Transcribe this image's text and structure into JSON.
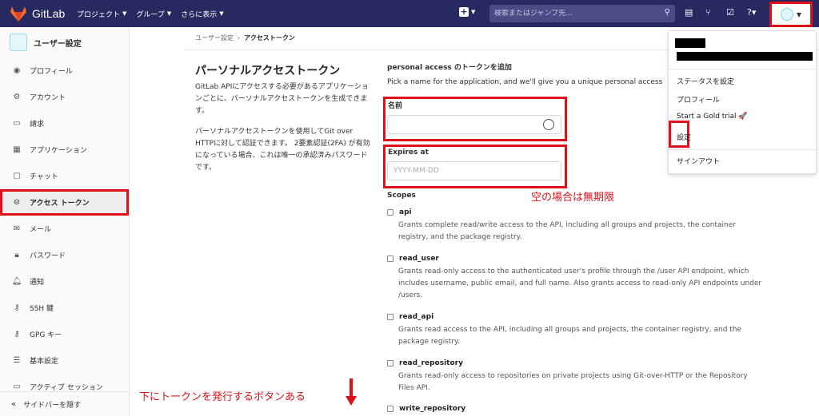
{
  "topbar": {
    "logo_text": "GitLab",
    "nav": [
      "プロジェクト",
      "グループ",
      "さらに表示"
    ],
    "search_placeholder": "検索またはジャンプ先..."
  },
  "sidebar": {
    "title": "ユーザー設定",
    "items": [
      {
        "label": "プロフィール",
        "icon": "user-circle-icon"
      },
      {
        "label": "アカウント",
        "icon": "account-icon"
      },
      {
        "label": "請求",
        "icon": "credit-card-icon"
      },
      {
        "label": "アプリケーション",
        "icon": "applications-icon"
      },
      {
        "label": "チャット",
        "icon": "chat-icon"
      },
      {
        "label": "アクセス トークン",
        "icon": "token-icon"
      },
      {
        "label": "メール",
        "icon": "mail-icon"
      },
      {
        "label": "パスワード",
        "icon": "lock-icon"
      },
      {
        "label": "通知",
        "icon": "bell-icon"
      },
      {
        "label": "SSH 鍵",
        "icon": "key-icon"
      },
      {
        "label": "GPG キー",
        "icon": "key-icon"
      },
      {
        "label": "基本設定",
        "icon": "settings-icon"
      },
      {
        "label": "アクティブ セッション",
        "icon": "monitor-icon"
      }
    ],
    "collapse_label": "サイドバーを隠す"
  },
  "breadcrumb": {
    "parent": "ユーザー設定",
    "current": "アクセストークン"
  },
  "page": {
    "title": "パーソナルアクセストークン",
    "desc1": "GitLab APIにアクセスする必要があるアプリケーションごとに、パーソナルアクセストークンを生成できます。",
    "desc2": "パーソナルアクセストークンを使用してGit over HTTPに対して認証できます。 2要素認証(2FA) が有効になっている場合、これは唯一の承認済みパスワードです。"
  },
  "form": {
    "title": "personal access のトークンを追加",
    "hint": "Pick a name for the application, and we'll give you a unique personal access",
    "name_label": "名前",
    "name_value": "",
    "expires_label": "Expires at",
    "expires_placeholder": "YYYY-MM-DD",
    "scopes_label": "Scopes",
    "scopes": [
      {
        "name": "api",
        "desc": "Grants complete read/write access to the API, including all groups and projects, the container registry, and the package registry."
      },
      {
        "name": "read_user",
        "desc": "Grants read-only access to the authenticated user's profile through the /user API endpoint, which includes username, public email, and full name. Also grants access to read-only API endpoints under /users."
      },
      {
        "name": "read_api",
        "desc": "Grants read access to the API, including all groups and projects, the container registry, and the package registry."
      },
      {
        "name": "read_repository",
        "desc": "Grants read-only access to repositories on private projects using Git-over-HTTP or the Repository Files API."
      },
      {
        "name": "write_repository",
        "desc": ""
      }
    ]
  },
  "annotations": {
    "expiry_note": "空の場合は無期限",
    "bottom_note": "下にトークンを発行するボタンある"
  },
  "dropdown": {
    "items": [
      "ステータスを設定",
      "プロフィール",
      "Start a Gold trial 🚀",
      "設定",
      "サインアウト"
    ]
  }
}
